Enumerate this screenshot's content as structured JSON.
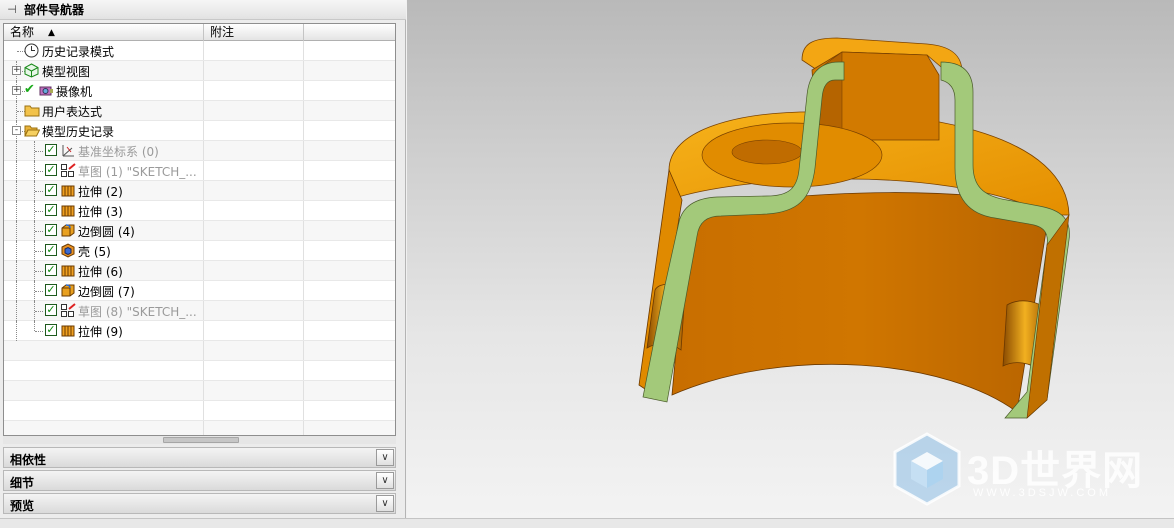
{
  "navigator": {
    "title": "部件导航器",
    "columns": {
      "name": "名称",
      "note": "附注"
    },
    "rows": [
      {
        "label": "历史记录模式",
        "icon": "clock-icon",
        "level": 0,
        "expander": "none"
      },
      {
        "label": "模型视图",
        "icon": "model-views-icon",
        "level": 0,
        "expander": "+"
      },
      {
        "label": "摄像机",
        "icon": "camera-icon",
        "level": 0,
        "expander": "+",
        "check": "✔"
      },
      {
        "label": "用户表达式",
        "icon": "folder-icon",
        "level": 0,
        "expander": "none"
      },
      {
        "label": "模型历史记录",
        "icon": "folder-open-icon",
        "level": 0,
        "expander": "-"
      },
      {
        "label": "基准坐标系 (0)",
        "icon": "datum-csys-icon",
        "level": 1,
        "grey": true
      },
      {
        "label": "草图 (1) \"SKETCH_...",
        "icon": "sketch-icon",
        "level": 1,
        "grey": true
      },
      {
        "label": "拉伸 (2)",
        "icon": "extrude-icon",
        "level": 1
      },
      {
        "label": "拉伸 (3)",
        "icon": "extrude-icon",
        "level": 1
      },
      {
        "label": "边倒圆 (4)",
        "icon": "edge-blend-icon",
        "level": 1
      },
      {
        "label": "壳 (5)",
        "icon": "shell-icon",
        "level": 1
      },
      {
        "label": "拉伸 (6)",
        "icon": "extrude-icon",
        "level": 1
      },
      {
        "label": "边倒圆 (7)",
        "icon": "edge-blend-icon",
        "level": 1
      },
      {
        "label": "草图 (8) \"SKETCH_...",
        "icon": "sketch-icon",
        "level": 1,
        "grey": true
      },
      {
        "label": "拉伸 (9)",
        "icon": "extrude-icon",
        "level": 1
      }
    ],
    "empty_rows": 5
  },
  "sections": [
    {
      "label": "相依性",
      "button": "∨"
    },
    {
      "label": "细节",
      "button": "∨"
    },
    {
      "label": "预览",
      "button": "∨"
    }
  ],
  "watermark": {
    "title": "3D世界网",
    "url": "WWW.3DSJW.COM"
  },
  "colors": {
    "model_orange": "#d97a00",
    "model_section_green": "#a3c97a",
    "viewport_top": "#b9b9b9",
    "viewport_bottom": "#f3f3f3"
  }
}
